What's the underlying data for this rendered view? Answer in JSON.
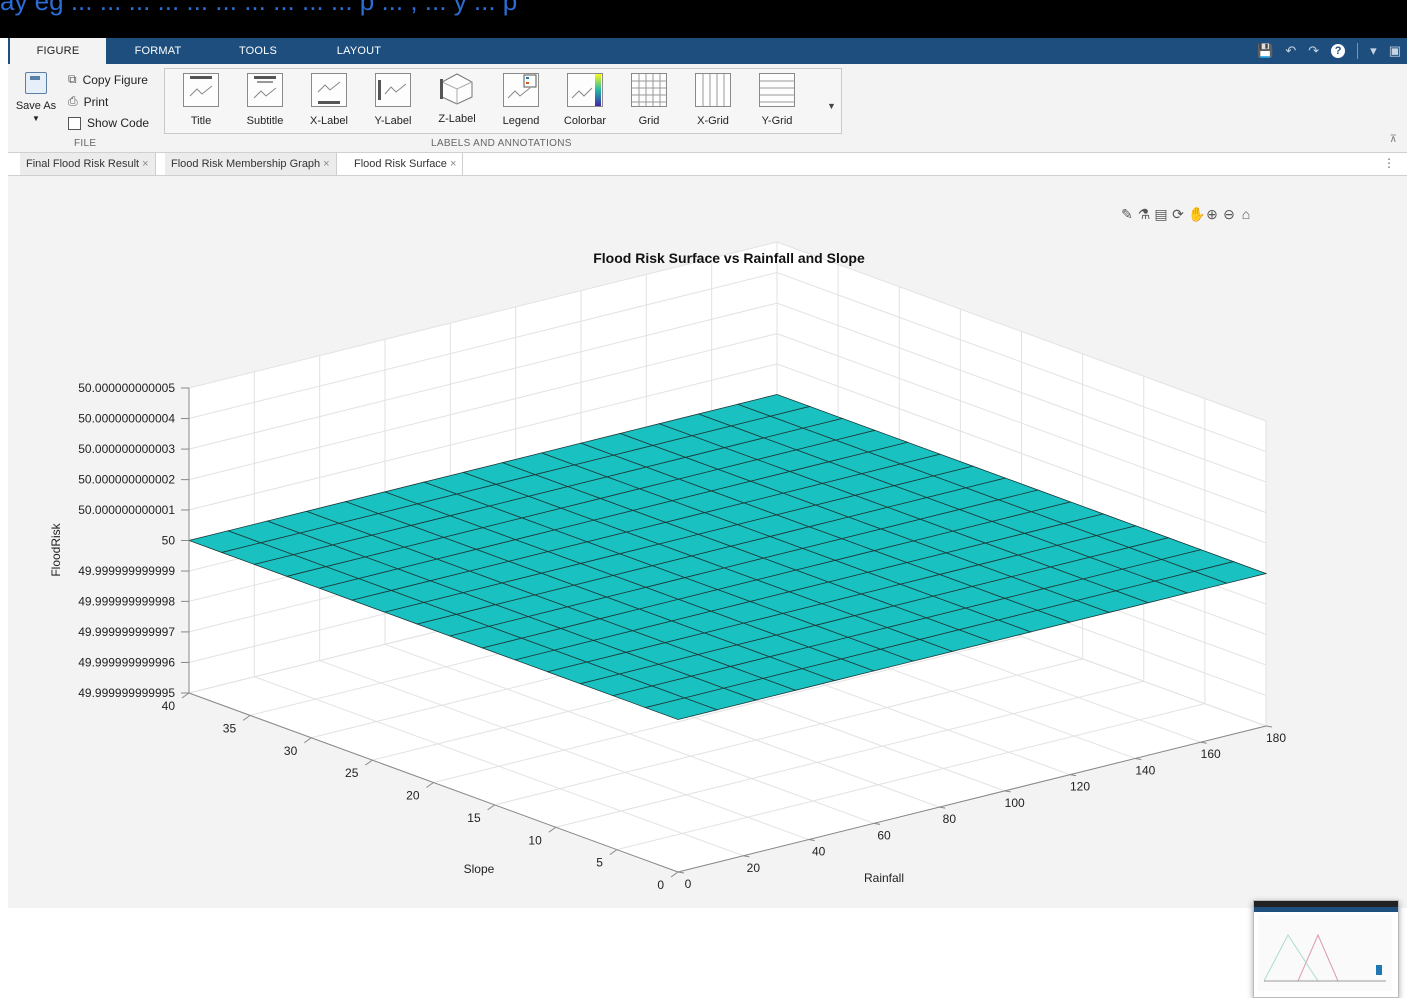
{
  "top_strip_text": "ay eg ... ... ... ... ... ... ... ... ... ... p ... , ... y ... p",
  "ribbon": {
    "tabs": [
      {
        "label": "FIGURE",
        "active": true
      },
      {
        "label": "FORMAT",
        "active": false
      },
      {
        "label": "TOOLS",
        "active": false
      },
      {
        "label": "LAYOUT",
        "active": false
      }
    ],
    "quick_access_icons": [
      "save-icon",
      "undo-icon",
      "redo-icon",
      "help-icon",
      "dropdown-icon",
      "undock-icon"
    ],
    "file": {
      "section_label": "FILE",
      "save_as": "Save As",
      "copy_figure": "Copy Figure",
      "print": "Print",
      "show_code": "Show Code"
    },
    "labels_annotations": {
      "section_label": "LABELS AND ANNOTATIONS",
      "buttons": [
        "Title",
        "Subtitle",
        "X-Label",
        "Y-Label",
        "Z-Label",
        "Legend",
        "Colorbar",
        "Grid",
        "X-Grid",
        "Y-Grid"
      ]
    }
  },
  "document_tabs": [
    {
      "label": "Final Flood Risk Result",
      "active": false
    },
    {
      "label": "Flood Risk Membership Graph",
      "active": false
    },
    {
      "label": "Flood Risk Surface",
      "active": true
    }
  ],
  "axes_toolbar_icons": [
    "brush-icon",
    "data-tips-icon",
    "legend-icon",
    "rotate-icon",
    "pan-icon",
    "zoom-in-icon",
    "zoom-out-icon",
    "home-icon"
  ],
  "chart_data": {
    "type": "surface",
    "title": "Flood Risk Surface vs Rainfall and Slope",
    "xlabel": "Rainfall",
    "ylabel": "Slope",
    "zlabel": "FloodRisk",
    "x_ticks": [
      "0",
      "20",
      "40",
      "60",
      "80",
      "100",
      "120",
      "140",
      "160",
      "180"
    ],
    "y_ticks": [
      "0",
      "5",
      "10",
      "15",
      "20",
      "25",
      "30",
      "35",
      "40"
    ],
    "z_ticks": [
      "49.999999999995",
      "49.999999999996",
      "49.999999999997",
      "49.999999999998",
      "49.999999999999",
      "50",
      "50.000000000001",
      "50.000000000002",
      "50.000000000003",
      "50.000000000004",
      "50.000000000005"
    ],
    "xlim": [
      0,
      180
    ],
    "ylim": [
      0,
      40
    ],
    "zlim": [
      49.999999999995,
      50.000000000005
    ],
    "z_value": 50,
    "mesh_divisions": 15,
    "surface_color": "#1ac1c1",
    "grid": true
  }
}
